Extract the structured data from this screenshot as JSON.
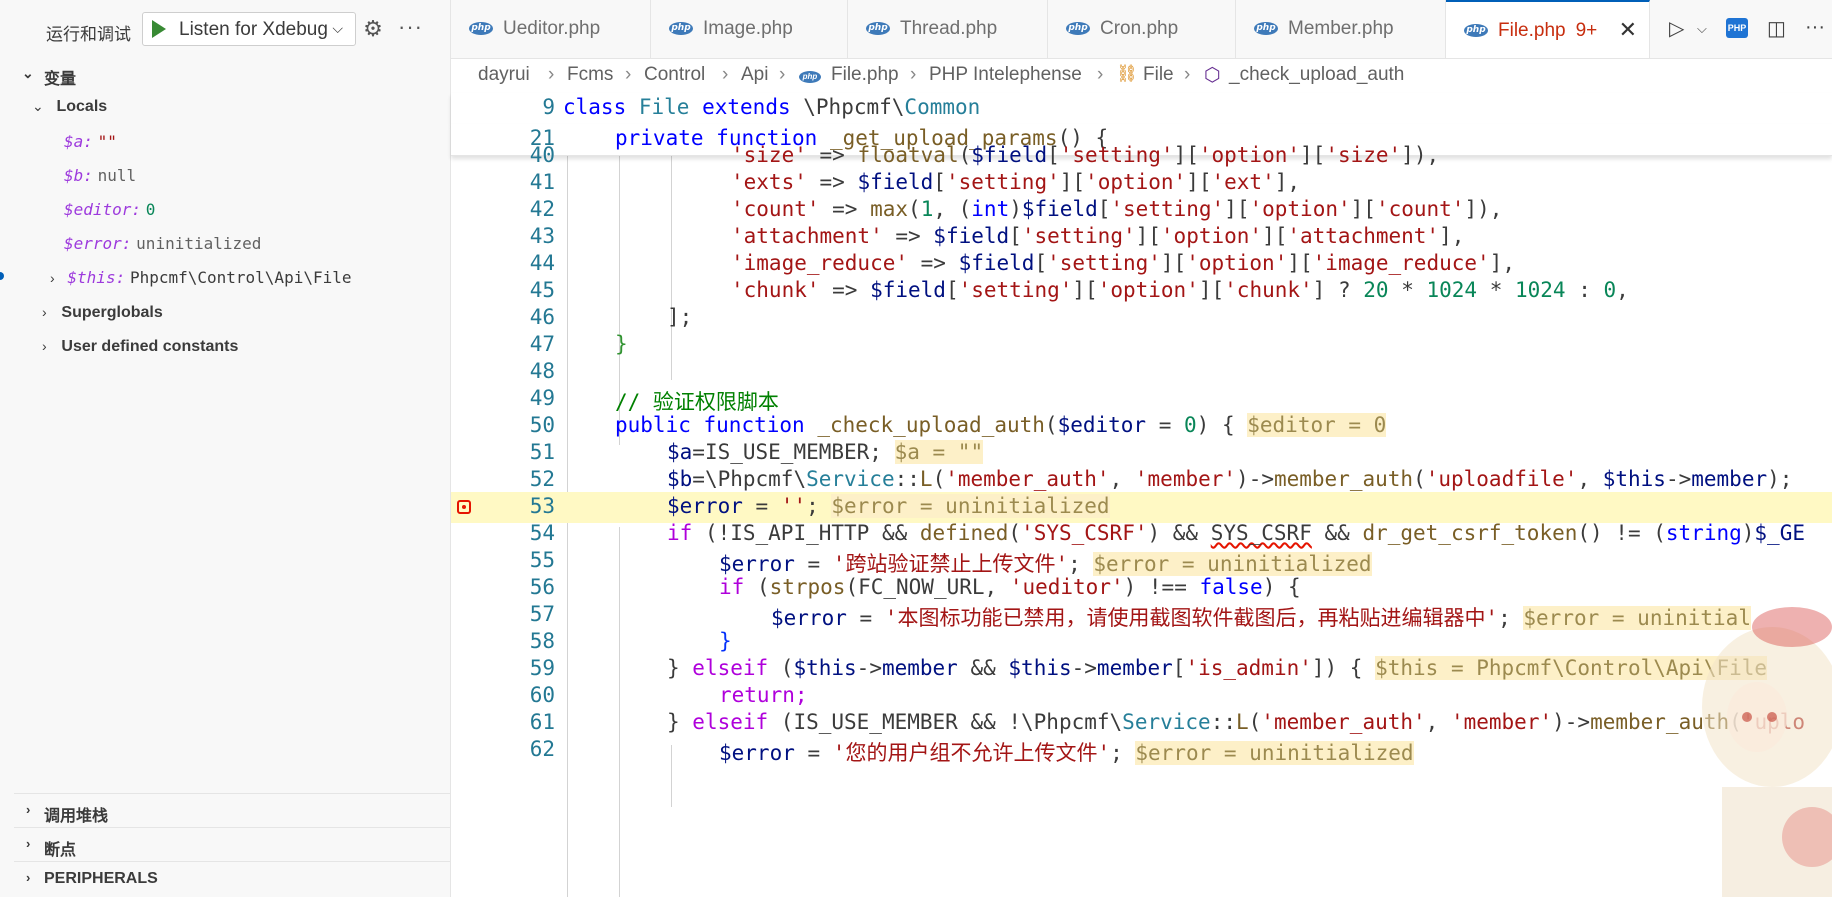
{
  "sidebar": {
    "title": "运行和调试",
    "run_config": "Listen for Xdebug",
    "variables_section": "变量",
    "locals_label": "Locals",
    "locals": [
      {
        "name": "$a:",
        "value": "\"\""
      },
      {
        "name": "$b:",
        "value": "null"
      },
      {
        "name": "$editor:",
        "value": "0"
      },
      {
        "name": "$error:",
        "value": "uninitialized"
      },
      {
        "name": "$this:",
        "value": "Phpcmf\\Control\\Api\\File"
      }
    ],
    "superglobals_label": "Superglobals",
    "user_constants_label": "User defined constants",
    "callstack_label": "调用堆栈",
    "breakpoints_label": "断点",
    "peripherals_label": "PERIPHERALS"
  },
  "tabs": [
    {
      "name": "Ueditor.php"
    },
    {
      "name": "Image.php"
    },
    {
      "name": "Thread.php"
    },
    {
      "name": "Cron.php"
    },
    {
      "name": "Member.php"
    },
    {
      "name": "File.php",
      "badge": "9+"
    }
  ],
  "icons": {
    "php": "php",
    "gear": "gear-icon",
    "more": "ellipsis-icon",
    "close": "close-icon",
    "run": "run-icon",
    "split": "split-editor-icon"
  },
  "breadcrumbs": [
    "dayrui",
    "Fcms",
    "Control",
    "Api",
    "File.php",
    "PHP Intelephense",
    "File",
    "_check_upload_auth"
  ],
  "code": {
    "sticky": [
      {
        "ln": "9",
        "text": "class File extends \\Phpcmf\\Common"
      },
      {
        "ln": "21",
        "text": "private function _get_upload_params() {"
      }
    ],
    "lines": [
      {
        "ln": "40",
        "text": "'size' => floatval($field['setting']['option']['size']),"
      },
      {
        "ln": "41",
        "text": "'exts' => $field['setting']['option']['ext'],"
      },
      {
        "ln": "42",
        "text": "'count' => max(1, (int)$field['setting']['option']['count']),"
      },
      {
        "ln": "43",
        "text": "'attachment' => $field['setting']['option']['attachment'],"
      },
      {
        "ln": "44",
        "text": "'image_reduce' => $field['setting']['option']['image_reduce'],"
      },
      {
        "ln": "45",
        "text": "'chunk' => $field['setting']['option']['chunk'] ? 20 * 1024 * 1024 : 0,"
      },
      {
        "ln": "46",
        "text": "];"
      },
      {
        "ln": "47",
        "text": "}"
      },
      {
        "ln": "48",
        "text": ""
      },
      {
        "ln": "49",
        "text": "// 验证权限脚本"
      },
      {
        "ln": "50",
        "text": "public function _check_upload_auth($editor = 0) {",
        "inline": "$editor = 0"
      },
      {
        "ln": "51",
        "text": "$a=IS_USE_MEMBER;",
        "inline": "$a = \"\""
      },
      {
        "ln": "52",
        "text": "$b=\\Phpcmf\\Service::L('member_auth', 'member')->member_auth('uploadfile', $this->member);"
      },
      {
        "ln": "53",
        "text": "$error = '';",
        "inline": "$error = uninitialized"
      },
      {
        "ln": "54",
        "text": "if (!IS_API_HTTP && defined('SYS_CSRF') && SYS_CSRF && dr_get_csrf_token() != (string)$_GE"
      },
      {
        "ln": "55",
        "text": "$error = '跨站验证禁止上传文件';",
        "inline": "$error = uninitialized"
      },
      {
        "ln": "56",
        "text": "if (strpos(FC_NOW_URL, 'ueditor') !== false) {"
      },
      {
        "ln": "57",
        "text": "$error = '本图标功能已禁用，请使用截图软件截图后，再粘贴进编辑器中';",
        "inline": "$error = uninitial"
      },
      {
        "ln": "58",
        "text": "}"
      },
      {
        "ln": "59",
        "text": "} elseif ($this->member && $this->member['is_admin']) {",
        "inline": "$this = Phpcmf\\Control\\Api\\File"
      },
      {
        "ln": "60",
        "text": "return;"
      },
      {
        "ln": "61",
        "text": "} elseif (IS_USE_MEMBER && !\\Phpcmf\\Service::L('member_auth', 'member')->member_auth('uplo"
      },
      {
        "ln": "62",
        "text": "$error = '您的用户组不允许上传文件';",
        "inline": "$error = uninitialized"
      }
    ]
  }
}
